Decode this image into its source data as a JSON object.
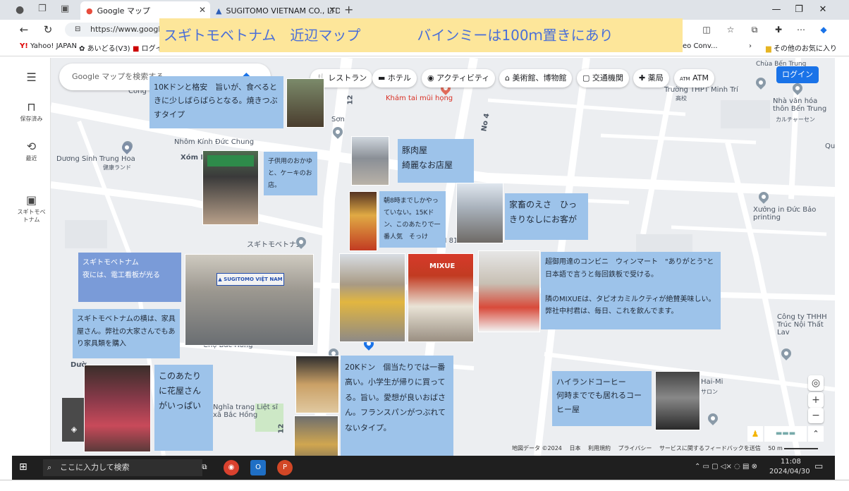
{
  "browser": {
    "tabs": [
      {
        "label": "Google マップ"
      },
      {
        "label": "SUGITOMO VIETNAM CO., LTD"
      }
    ],
    "url": "https://www.google.",
    "bookmarks": [
      "Yahoo! JAPAN",
      "あいどる(V3)",
      "ログイ",
      "eo Conv...",
      "その他のお気に入り"
    ]
  },
  "banner": {
    "text": "スギトモベトナム　近辺マップ　　　　バインミーは100ｍ置きにあり"
  },
  "map": {
    "search_placeholder": "Google マップを検索する",
    "chips": [
      "レストラン",
      "ホテル",
      "アクティビティ",
      "美術館、博物館",
      "交通機関",
      "薬局",
      "ATM"
    ],
    "login_label": "ログイン",
    "left_rail": [
      {
        "label": "保存済み"
      },
      {
        "label": "最近"
      },
      {
        "label": "スギトモベトナム"
      }
    ],
    "labels": [
      "Nhôm Kính Đức Chung",
      "Dương Sinh Trung Hoa",
      "健康ランド",
      "Xóm M",
      "Khám tai mũi họng",
      "No 4",
      "Chùa Bến Trung",
      "Trường THPT Minh Trí",
      "高校",
      "Nhà văn hóa thôn Bến Trung",
      "カルチャーセン",
      "Xưởng in Đức Bảo printing",
      "スギトモベトナム",
      "Chợ Bắc Hồng",
      "Nghĩa trang Liệt sĩ xã Bắc Hồng",
      "Công ty THHH Trúc Nội Thất Lav",
      "Hai-Mi",
      "サロン",
      "Sơn",
      "Cồng ty",
      "Dườ",
      "12",
      "12",
      "N 81",
      "Qu"
    ],
    "attribution": [
      "地図データ ©2024",
      "日本",
      "利用規約",
      "プライバシー",
      "サービスに関するフィードバックを送信",
      "50 m"
    ]
  },
  "notes": {
    "banhmi_cheap": "10Kドンと格安　旨いが、食べるときに少しばらばらとなる。焼きつぶすタイプ",
    "kids_snack": "子供用のおかゆと、ケーキのお店。",
    "pork_shop": "豚肉屋\n綺麗なお店屋",
    "morning_shop": "朝8時までしかやっていない。15Kドン、このあたりで一番人気　そっけ",
    "livestock_feed": "家畜のえさ　ひっきりなしにお客が",
    "sugitomo_night": "スギトモベトナム\n夜には、電工看板が光る",
    "furniture_shop": "スギトモベトナムの横は、家具屋さん。弊社の大家さんでもあり家具類を購入",
    "flower_shops": "このあたりに花屋さんがいっぱい",
    "banhmi_expensive": "20Kドン　個当たりでは一番高い。小学生が帰りに買ってる。旨い。愛想が良いおばさん。フランスパンがつぶれてないタイプ。",
    "winmart": "超御用達のコンビニ　ウィンマート　\"ありがとう\"と日本語で言うと毎回鉄板で受ける。\n\n隣のMIXUEは、タピオカミルクティが絶賛美味しい。弊社中村君は、毎日、これを飲んでます。",
    "highlands": "ハイランドコーヒー\n何時まででも居れるコーヒー屋"
  },
  "photos": {
    "sugitomo_sign": "SUGITOMO VIỆT NAM",
    "mixue_sign": "MIXUE"
  },
  "taskbar": {
    "search_placeholder": "ここに入力して検索",
    "time": "11:08",
    "date": "2024/04/30"
  },
  "colors": {
    "note_blue": "#9dc3ea",
    "note_dark": "#7a9bd8",
    "banner_bg": "#fde69a",
    "banner_text": "#4a6fd8",
    "login_blue": "#1a73e8"
  }
}
